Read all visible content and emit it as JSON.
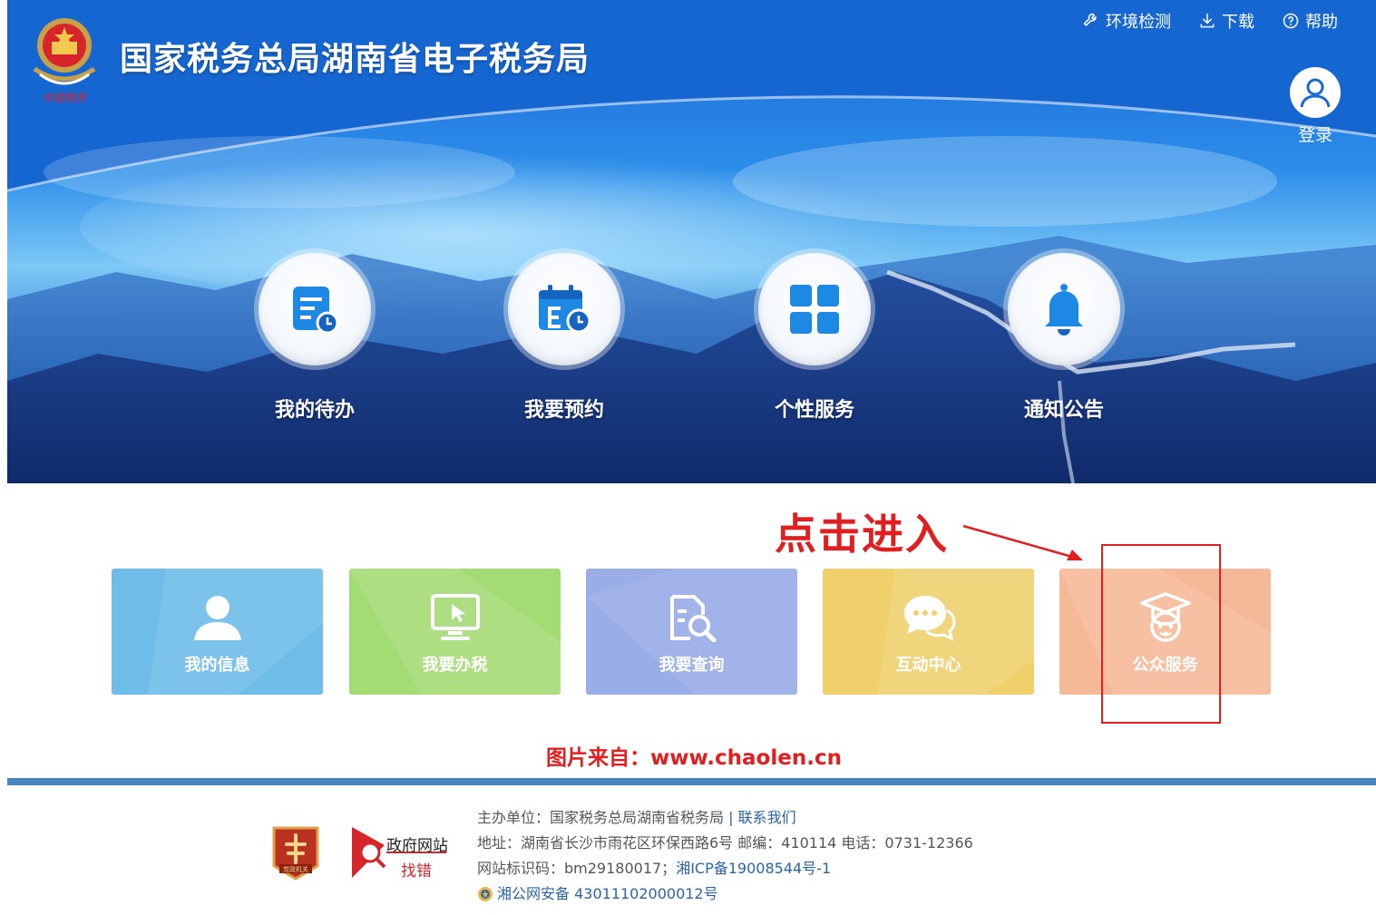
{
  "header": {
    "title": "国家税务总局湖南省电子税务局",
    "links": [
      {
        "label": "环境检测",
        "icon": "wrench-icon"
      },
      {
        "label": "下载",
        "icon": "download-icon"
      },
      {
        "label": "帮助",
        "icon": "help-icon"
      }
    ],
    "login_label": "登录"
  },
  "features": [
    {
      "label": "我的待办",
      "icon": "todo-list-icon"
    },
    {
      "label": "我要预约",
      "icon": "calendar-clock-icon"
    },
    {
      "label": "个性服务",
      "icon": "grid-icon"
    },
    {
      "label": "通知公告",
      "icon": "bell-icon"
    }
  ],
  "hint": "点击进入",
  "tiles": [
    {
      "label": "我的信息",
      "icon": "user-icon",
      "color": "#6dbde8"
    },
    {
      "label": "我要办税",
      "icon": "monitor-icon",
      "color": "#a4dc74"
    },
    {
      "label": "我要查询",
      "icon": "document-search-icon",
      "color": "#9aade6"
    },
    {
      "label": "互动中心",
      "icon": "chat-icon",
      "color": "#f0d06a"
    },
    {
      "label": "公众服务",
      "icon": "graduate-icon",
      "color": "#f6b998"
    }
  ],
  "watermark": "图片来自：www.chaolen.cn",
  "footer": {
    "host_prefix": "主办单位：国家税务总局湖南省税务局",
    "sep": "|",
    "contact": "联系我们",
    "address": "地址：湖南省长沙市雨花区环保西路6号 邮编：410114 电话：0731-12366",
    "site_code_prefix": "网站标识码：bm29180017；",
    "icp": "湘ICP备19008544号-1",
    "police": "湘公网安备 43011102000012号",
    "badge2_top": "政府网站",
    "badge2_bottom": "找错",
    "badge1_text": "党政机关"
  },
  "colors": {
    "primary_blue": "#1565d0",
    "red": "#e02020",
    "link": "#2a64a8"
  }
}
